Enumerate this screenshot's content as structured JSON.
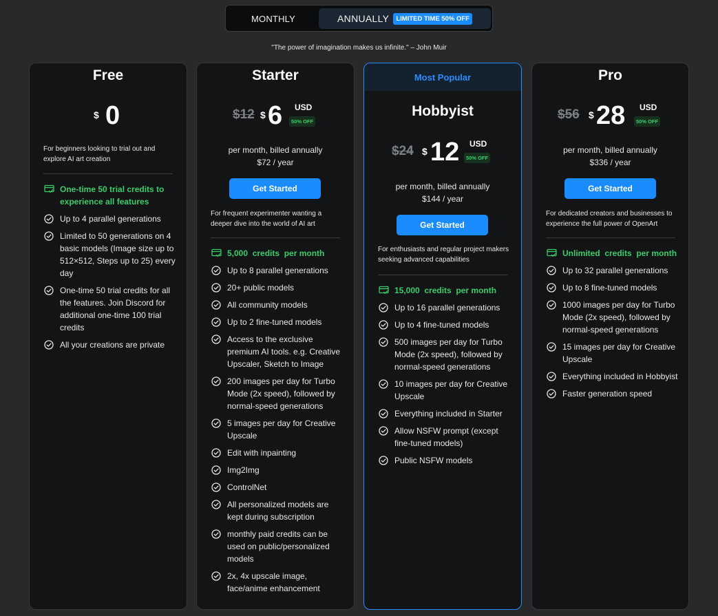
{
  "toggle": {
    "monthly": "MONTHLY",
    "annually": "ANNUALLY",
    "limited_tag": "LIMITED TIME 50% OFF"
  },
  "quote": "\"The power of imagination makes us infinite.\" – John Muir",
  "colors": {
    "accent": "#1a8cff",
    "credit_green": "#3ccc6a",
    "card_bg": "#121416",
    "page_bg": "#27292b"
  },
  "icons": {
    "check": "check-circle-icon",
    "credit": "credit-card-icon"
  },
  "plans": [
    {
      "name": "Free",
      "currency": "$",
      "price": "0",
      "desc": "For beginners looking to trial out and explore AI art creation",
      "features": [
        "One-time 50 trial credits to experience all features",
        "Up to 4 parallel generations",
        "Limited to 50 generations on 4 basic models (Image size up to 512×512, Steps up to 25) every day",
        "One-time 50 trial credits for all the features. Join Discord for additional one-time 100 trial credits",
        "All your creations are private"
      ]
    },
    {
      "name": "Starter",
      "old_price": "$12",
      "currency": "$",
      "price": "6",
      "unit": "USD",
      "discount": "50% OFF",
      "billing_line1": "per month, billed annually",
      "billing_line2": "$72 / year",
      "button": "Get Started",
      "desc": "For frequent experimenter wanting a deeper dive into the world of AI art",
      "features": [
        "5,000  credits  per month",
        "Up to 8 parallel generations",
        "20+ public models",
        "All community models",
        "Up to 2 fine-tuned models",
        "Access to the exclusive premium AI tools. e.g. Creative Upscaler, Sketch to Image",
        "200 images per day for Turbo Mode (2x speed), followed by normal-speed generations",
        "5 images per day for Creative Upscale",
        "Edit with inpainting",
        "Img2Img",
        "ControlNet",
        "All personalized models are kept during subscription",
        "monthly paid credits can be used on public/personalized models",
        "2x, 4x upscale image, face/anime enhancement"
      ]
    },
    {
      "name": "Hobbyist",
      "badge": "Most Popular",
      "old_price": "$24",
      "currency": "$",
      "price": "12",
      "unit": "USD",
      "discount": "50% OFF",
      "billing_line1": "per month, billed annually",
      "billing_line2": "$144 / year",
      "button": "Get Started",
      "desc": "For enthusiasts and regular project makers seeking advanced capabilities",
      "features": [
        "15,000  credits  per month",
        "Up to 16 parallel generations",
        "Up to 4 fine-tuned models",
        "500 images per day for Turbo Mode (2x speed), followed by normal-speed generations",
        "10 images per day for Creative Upscale",
        "Everything included in Starter",
        "Allow NSFW prompt (except fine-tuned models)",
        "Public NSFW models"
      ]
    },
    {
      "name": "Pro",
      "old_price": "$56",
      "currency": "$",
      "price": "28",
      "unit": "USD",
      "discount": "50% OFF",
      "billing_line1": "per month, billed annually",
      "billing_line2": "$336 / year",
      "button": "Get Started",
      "desc": "For dedicated creators and businesses to experience the full power of OpenArt",
      "features": [
        "Unlimited  credits  per month",
        "Up to 32 parallel generations",
        "Up to 8 fine-tuned models",
        "1000 images per day for Turbo Mode (2x speed), followed by normal-speed generations",
        "15 images per day for Creative Upscale",
        "Everything included in Hobbyist",
        "Faster generation speed"
      ]
    }
  ]
}
